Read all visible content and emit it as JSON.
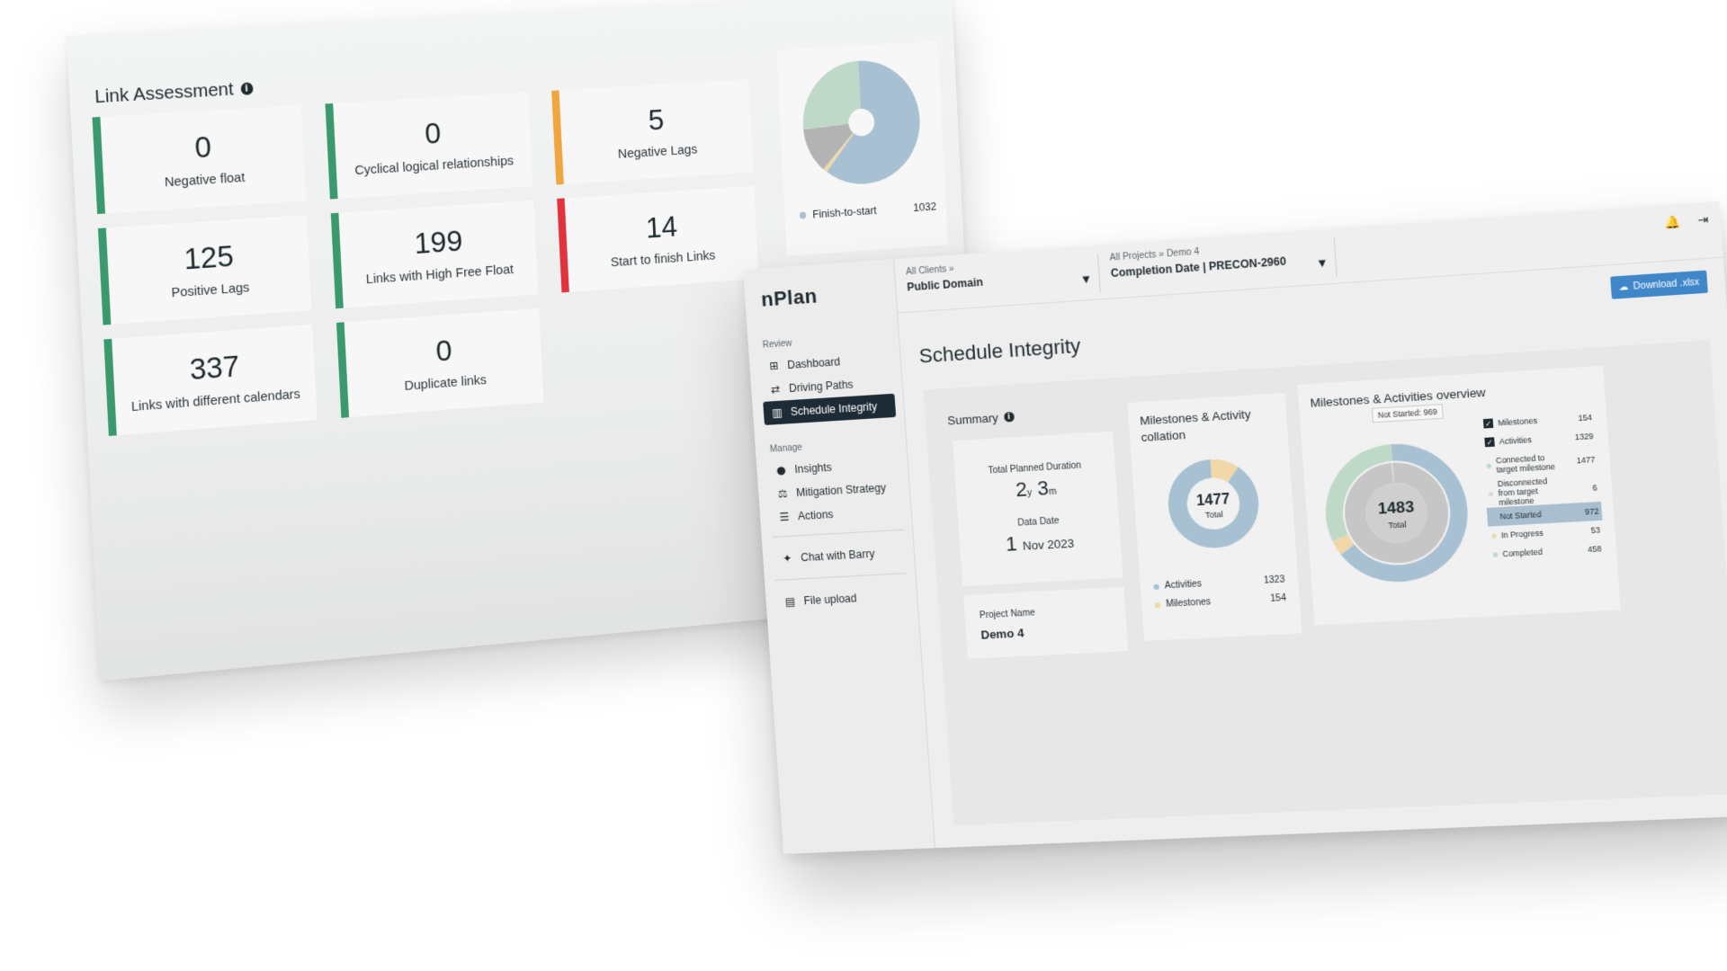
{
  "link_assessment": {
    "title": "Link Assessment",
    "info": "i",
    "cards": [
      {
        "value": "0",
        "label": "Negative float",
        "color": "#3a9a6e"
      },
      {
        "value": "0",
        "label": "Cyclical logical relationships",
        "color": "#3a9a6e"
      },
      {
        "value": "5",
        "label": "Negative Lags",
        "color": "#f0a540"
      },
      {
        "value": "125",
        "label": "Positive Lags",
        "color": "#3a9a6e"
      },
      {
        "value": "199",
        "label": "Links with High Free Float",
        "color": "#3a9a6e"
      },
      {
        "value": "14",
        "label": "Start to finish Links",
        "color": "#e0333d"
      },
      {
        "value": "337",
        "label": "Links with different calendars",
        "color": "#3a9a6e"
      },
      {
        "value": "0",
        "label": "Duplicate links",
        "color": "#3a9a6e"
      }
    ],
    "pie": {
      "legend_label": "Finish-to-start",
      "legend_value": "1032",
      "slice_colors": [
        "#a7c1d2",
        "#bfd9c8",
        "#b3b3b3",
        "#f0d8a8"
      ]
    }
  },
  "app": {
    "logo": "nPlan",
    "sidebar": {
      "section_review": "Review",
      "section_manage": "Manage",
      "items": [
        {
          "label": "Dashboard",
          "icon": "grid-icon"
        },
        {
          "label": "Driving Paths",
          "icon": "path-icon"
        },
        {
          "label": "Schedule Integrity",
          "icon": "chart-icon"
        },
        {
          "label": "Insights",
          "icon": "bulb-icon"
        },
        {
          "label": "Mitigation Strategy",
          "icon": "scale-icon"
        },
        {
          "label": "Actions",
          "icon": "list-icon"
        },
        {
          "label": "Chat with Barry",
          "icon": "sparkle-icon"
        },
        {
          "label": "File upload",
          "icon": "file-icon"
        }
      ]
    },
    "topbar": {
      "client_crumb": "All Clients »",
      "client_value": "Public Domain",
      "project_crumb": "All Projects » Demo 4",
      "project_value": "Completion Date | PRECON-2960"
    },
    "download_label": "Download .xlsx",
    "page_title": "Schedule Integrity",
    "summary": {
      "title": "Summary",
      "total_planned_duration_label": "Total Planned Duration",
      "duration_years": "2",
      "duration_years_unit": "y",
      "duration_months": "3",
      "duration_months_unit": "m",
      "data_date_label": "Data Date",
      "data_date_day": "1",
      "data_date_rest": "Nov 2023",
      "project_name_label": "Project Name",
      "project_name": "Demo 4"
    },
    "collation": {
      "title": "Milestones & Activity collation",
      "total": "1477",
      "total_label": "Total",
      "activities_label": "Activities",
      "activities_value": 1323,
      "milestones_label": "Milestones",
      "milestones_value": 154,
      "colors": {
        "activities": "#a7c1d2",
        "milestones": "#f0d8a8"
      }
    },
    "overview": {
      "title": "Milestones & Activities overview",
      "total": "1483",
      "total_label": "Total",
      "tooltip": "Not Started: 969",
      "rows": [
        {
          "label": "Milestones",
          "value": "154",
          "kind": "check"
        },
        {
          "label": "Activities",
          "value": "1329",
          "kind": "check"
        },
        {
          "label": "Connected to target milestone",
          "value": "1477",
          "kind": "dot",
          "color": "#bfd9c8"
        },
        {
          "label": "Disconnected from target milestone",
          "value": "6",
          "kind": "dot",
          "color": "#d8d8d8"
        },
        {
          "label": "Not Started",
          "value": "972",
          "kind": "dot",
          "color": "#a7c1d2",
          "selected": true
        },
        {
          "label": "In Progress",
          "value": "53",
          "kind": "dot",
          "color": "#f0d8a8"
        },
        {
          "label": "Completed",
          "value": "458",
          "kind": "dot",
          "color": "#bfd9c8"
        }
      ],
      "inner_ring": {
        "connected": 1477,
        "disconnected": 6
      },
      "outer_ring": {
        "not_started": 972,
        "in_progress": 53,
        "completed": 458
      }
    }
  }
}
